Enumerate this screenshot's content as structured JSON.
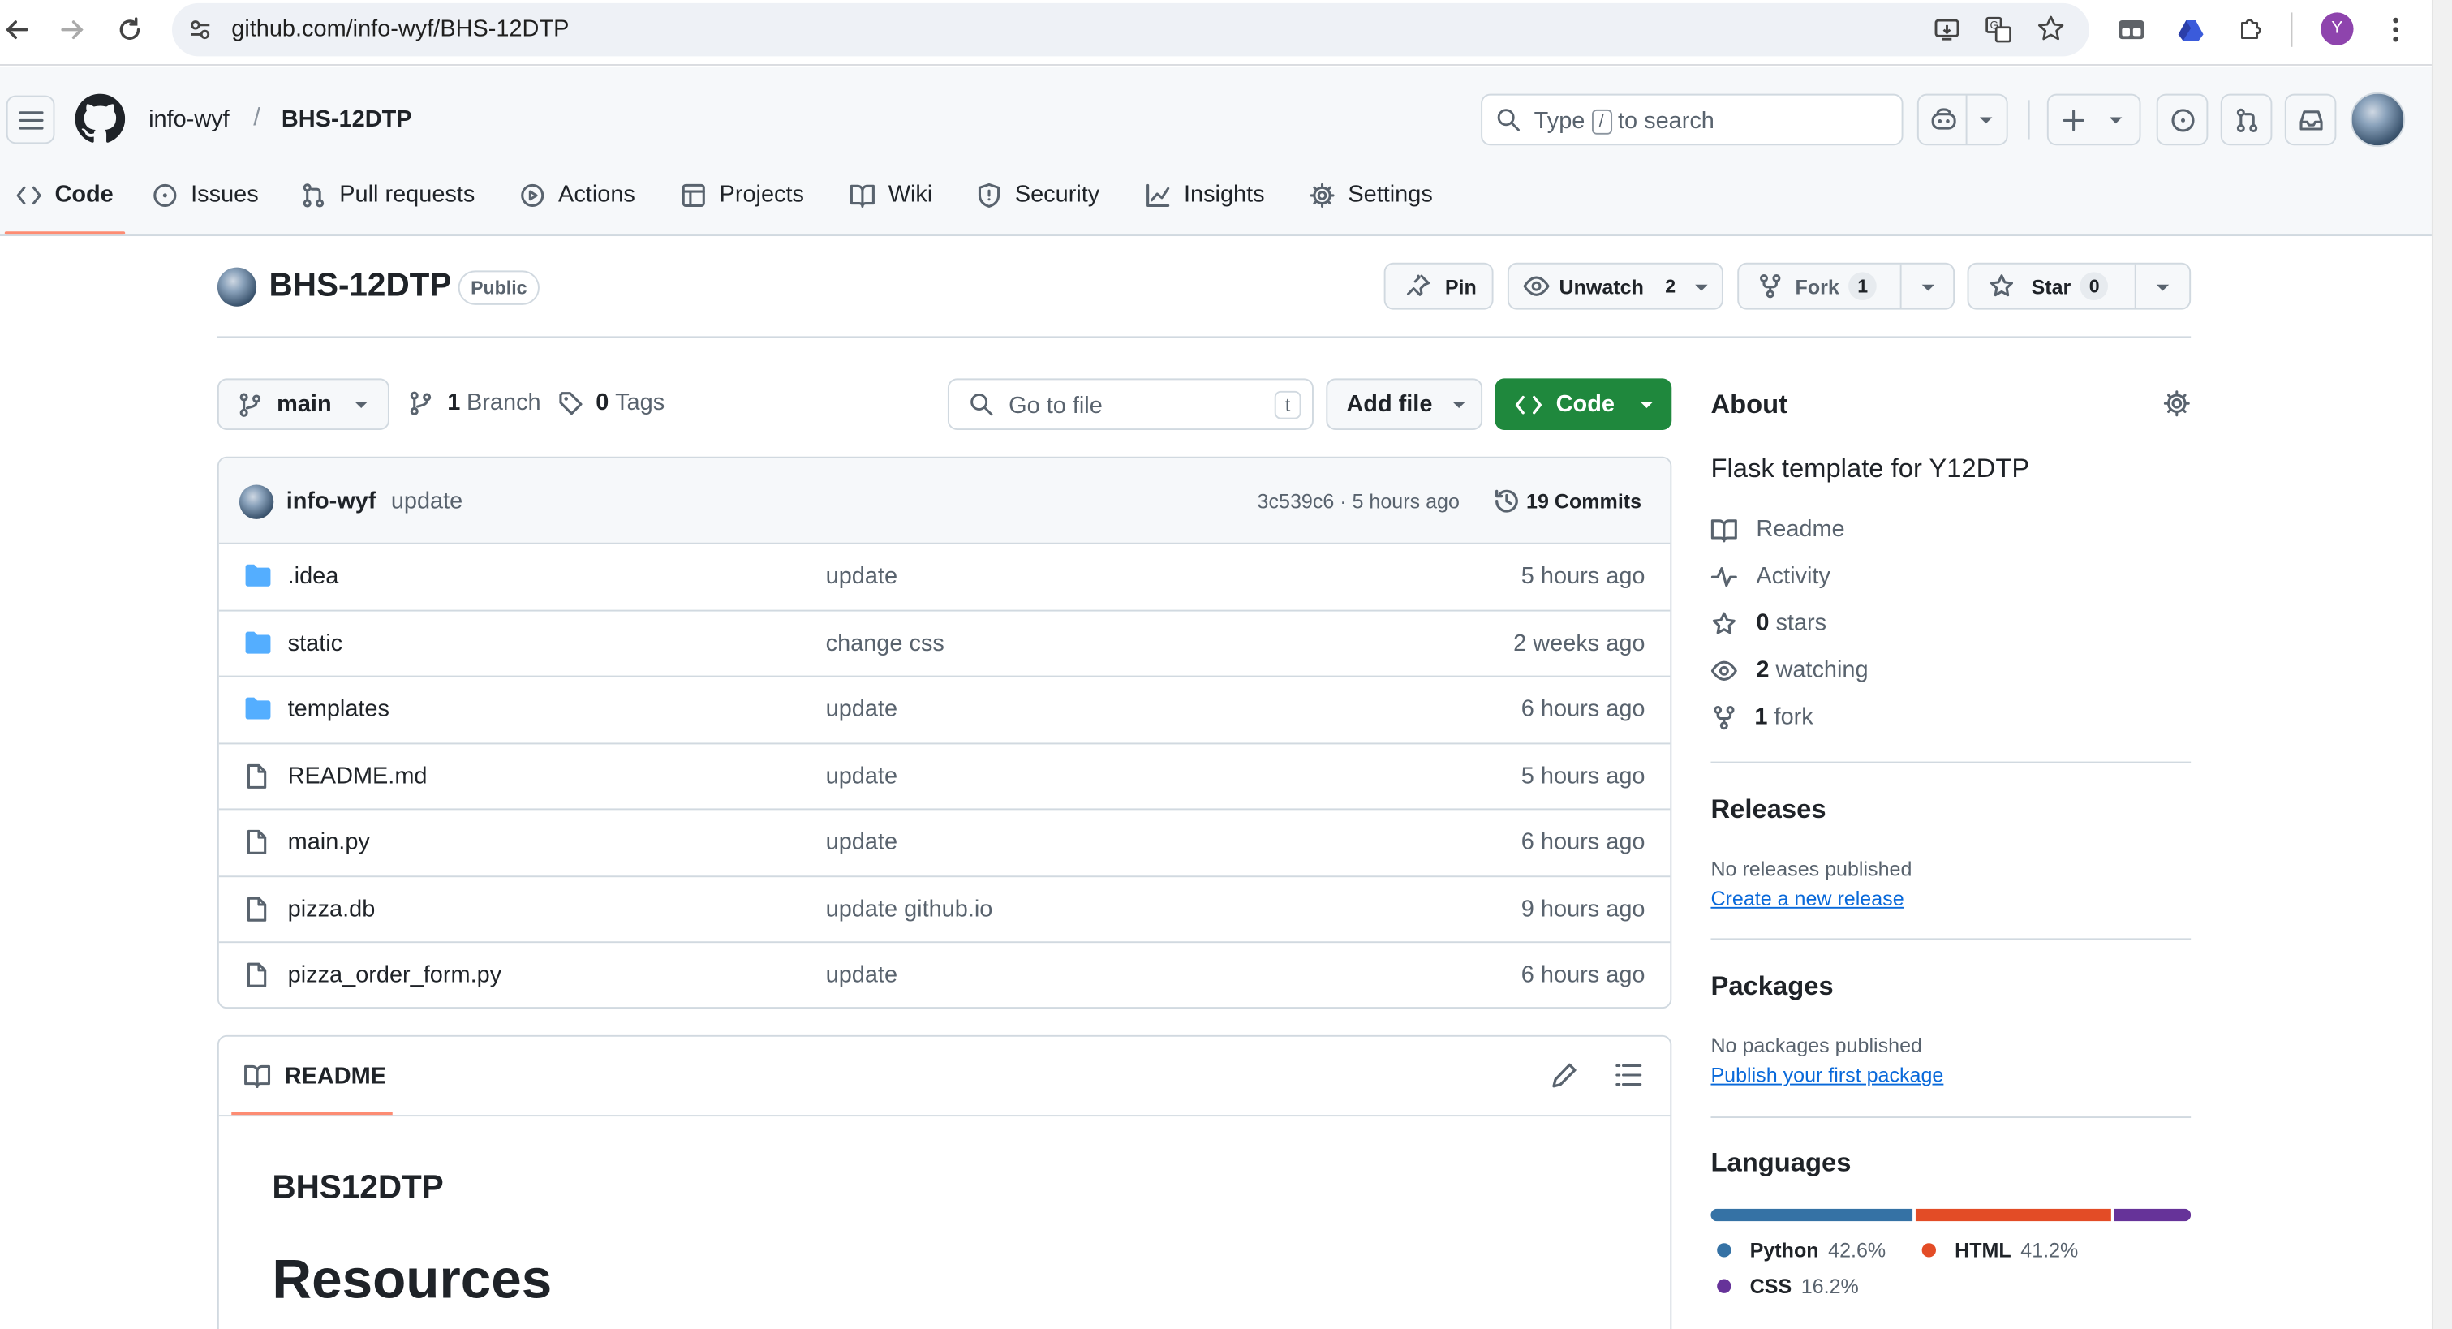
{
  "browser": {
    "url": "github.com/info-wyf/BHS-12DTP",
    "profile_initial": "Y"
  },
  "header": {
    "owner": "info-wyf",
    "separator": "/",
    "repo": "BHS-12DTP",
    "search_pre": "Type",
    "search_key": "/",
    "search_post": "to search"
  },
  "tabs": [
    {
      "label": "Code",
      "icon": "code-icon"
    },
    {
      "label": "Issues",
      "icon": "issue-icon"
    },
    {
      "label": "Pull requests",
      "icon": "pr-icon"
    },
    {
      "label": "Actions",
      "icon": "play-icon"
    },
    {
      "label": "Projects",
      "icon": "table-icon"
    },
    {
      "label": "Wiki",
      "icon": "book-icon"
    },
    {
      "label": "Security",
      "icon": "shield-icon"
    },
    {
      "label": "Insights",
      "icon": "graph-icon"
    },
    {
      "label": "Settings",
      "icon": "gear-icon"
    }
  ],
  "repo": {
    "name": "BHS-12DTP",
    "visibility": "Public",
    "pin": "Pin",
    "unwatch": "Unwatch",
    "watch_count": "2",
    "fork": "Fork",
    "fork_count": "1",
    "star": "Star",
    "star_count": "0"
  },
  "toolbar": {
    "branch": "main",
    "branches_count": "1",
    "branches_label": "Branch",
    "tags_count": "0",
    "tags_label": "Tags",
    "goto_placeholder": "Go to file",
    "goto_key": "t",
    "add_file": "Add file",
    "code": "Code"
  },
  "commit": {
    "author": "info-wyf",
    "message": "update",
    "hash_time": "3c539c6 · 5 hours ago",
    "commits": "19 Commits"
  },
  "files": [
    {
      "name": ".idea",
      "type": "folder",
      "message": "update",
      "time": "5 hours ago"
    },
    {
      "name": "static",
      "type": "folder",
      "message": "change css",
      "time": "2 weeks ago"
    },
    {
      "name": "templates",
      "type": "folder",
      "message": "update",
      "time": "6 hours ago"
    },
    {
      "name": "README.md",
      "type": "file",
      "message": "update",
      "time": "5 hours ago"
    },
    {
      "name": "main.py",
      "type": "file",
      "message": "update",
      "time": "6 hours ago"
    },
    {
      "name": "pizza.db",
      "type": "file",
      "message": "update github.io",
      "time": "9 hours ago"
    },
    {
      "name": "pizza_order_form.py",
      "type": "file",
      "message": "update",
      "time": "6 hours ago"
    }
  ],
  "readme": {
    "tab": "README",
    "h2": "BHS12DTP",
    "h1": "Resources"
  },
  "about": {
    "title": "About",
    "description": "Flask template for Y12DTP",
    "readme": "Readme",
    "activity": "Activity",
    "stars_count": "0",
    "stars_label": "stars",
    "watching_count": "2",
    "watching_label": "watching",
    "fork_count": "1",
    "fork_label": "fork"
  },
  "releases": {
    "title": "Releases",
    "none": "No releases published",
    "link": "Create a new release"
  },
  "packages": {
    "title": "Packages",
    "none": "No packages published",
    "link": "Publish your first package"
  },
  "languages": {
    "title": "Languages",
    "items": [
      {
        "name": "Python",
        "percent": "42.6%",
        "value": 42.6,
        "color": "#3572A5"
      },
      {
        "name": "HTML",
        "percent": "41.2%",
        "value": 41.2,
        "color": "#e34c26"
      },
      {
        "name": "CSS",
        "percent": "16.2%",
        "value": 16.2,
        "color": "#663399"
      }
    ]
  }
}
